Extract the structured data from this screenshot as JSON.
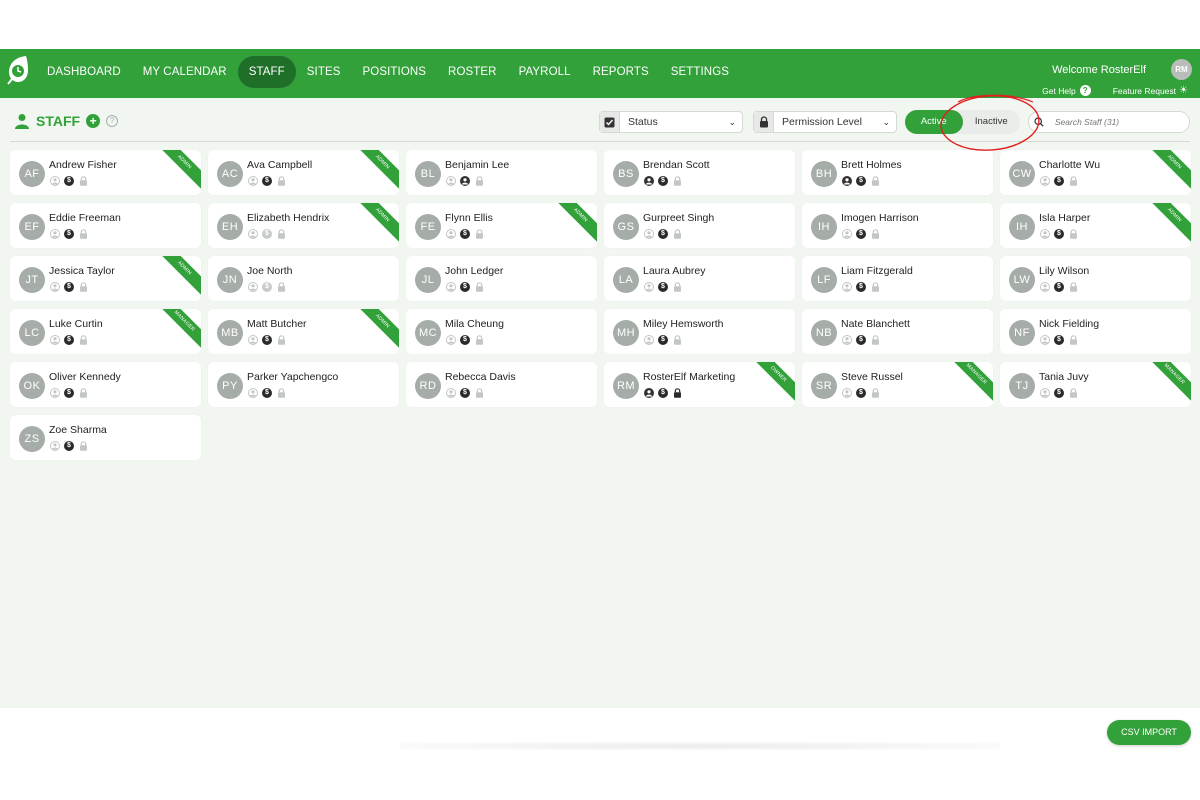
{
  "nav": {
    "items": [
      {
        "label": "DASHBOARD",
        "active": false
      },
      {
        "label": "MY CALENDAR",
        "active": false
      },
      {
        "label": "STAFF",
        "active": true
      },
      {
        "label": "SITES",
        "active": false
      },
      {
        "label": "POSITIONS",
        "active": false
      },
      {
        "label": "ROSTER",
        "active": false
      },
      {
        "label": "PAYROLL",
        "active": false
      },
      {
        "label": "REPORTS",
        "active": false
      },
      {
        "label": "SETTINGS",
        "active": false
      }
    ],
    "welcome": "Welcome RosterElf",
    "user_initials": "RM",
    "get_help": "Get Help",
    "feature_request": "Feature Request"
  },
  "page": {
    "title": "STAFF",
    "status_filter": "Status",
    "permission_filter": "Permission Level",
    "toggle_active": "Active",
    "toggle_inactive": "Inactive",
    "search_placeholder": "Search Staff (31)",
    "csv_import": "CSV IMPORT"
  },
  "colors": {
    "brand_green": "#33a13a",
    "active_nav": "#1f6f28",
    "annotation": "#e02020"
  },
  "staff": [
    {
      "initials": "AF",
      "name": "Andrew Fisher",
      "badge": "ADMIN",
      "icons": [
        "user-off",
        "dollar-on",
        "lock-off"
      ]
    },
    {
      "initials": "AC",
      "name": "Ava Campbell",
      "badge": "ADMIN",
      "icons": [
        "user-off",
        "dollar-on",
        "lock-off"
      ]
    },
    {
      "initials": "BL",
      "name": "Benjamin Lee",
      "badge": "",
      "icons": [
        "user-off",
        "user-on",
        "lock-off"
      ]
    },
    {
      "initials": "BS",
      "name": "Brendan Scott",
      "badge": "",
      "icons": [
        "user-on",
        "dollar-on",
        "lock-off"
      ]
    },
    {
      "initials": "BH",
      "name": "Brett Holmes",
      "badge": "",
      "icons": [
        "user-on",
        "dollar-on",
        "lock-off"
      ]
    },
    {
      "initials": "CW",
      "name": "Charlotte Wu",
      "badge": "ADMIN",
      "icons": [
        "user-off",
        "dollar-on",
        "lock-off"
      ]
    },
    {
      "initials": "EF",
      "name": "Eddie Freeman",
      "badge": "",
      "icons": [
        "user-off",
        "dollar-on",
        "lock-off"
      ]
    },
    {
      "initials": "EH",
      "name": "Elizabeth Hendrix",
      "badge": "ADMIN",
      "icons": [
        "user-off",
        "dollar-off",
        "lock-off"
      ]
    },
    {
      "initials": "FE",
      "name": "Flynn Ellis",
      "badge": "ADMIN",
      "icons": [
        "user-off",
        "dollar-on",
        "lock-off"
      ]
    },
    {
      "initials": "GS",
      "name": "Gurpreet Singh",
      "badge": "",
      "icons": [
        "user-off",
        "dollar-on",
        "lock-off"
      ]
    },
    {
      "initials": "IH",
      "name": "Imogen Harrison",
      "badge": "",
      "icons": [
        "user-off",
        "dollar-on",
        "lock-off"
      ]
    },
    {
      "initials": "IH",
      "name": "Isla Harper",
      "badge": "ADMIN",
      "icons": [
        "user-off",
        "dollar-on",
        "lock-off"
      ]
    },
    {
      "initials": "JT",
      "name": "Jessica Taylor",
      "badge": "ADMIN",
      "icons": [
        "user-off",
        "dollar-on",
        "lock-off"
      ]
    },
    {
      "initials": "JN",
      "name": "Joe North",
      "badge": "",
      "icons": [
        "user-off",
        "dollar-off",
        "lock-off"
      ]
    },
    {
      "initials": "JL",
      "name": "John Ledger",
      "badge": "",
      "icons": [
        "user-off",
        "dollar-on",
        "lock-off"
      ]
    },
    {
      "initials": "LA",
      "name": "Laura Aubrey",
      "badge": "",
      "icons": [
        "user-off",
        "dollar-on",
        "lock-off"
      ]
    },
    {
      "initials": "LF",
      "name": "Liam Fitzgerald",
      "badge": "",
      "icons": [
        "user-off",
        "dollar-on",
        "lock-off"
      ]
    },
    {
      "initials": "LW",
      "name": "Lily Wilson",
      "badge": "",
      "icons": [
        "user-off",
        "dollar-on",
        "lock-off"
      ]
    },
    {
      "initials": "LC",
      "name": "Luke Curtin",
      "badge": "MANAGER",
      "icons": [
        "user-off",
        "dollar-on",
        "lock-off"
      ]
    },
    {
      "initials": "MB",
      "name": "Matt Butcher",
      "badge": "ADMIN",
      "icons": [
        "user-off",
        "dollar-on",
        "lock-off"
      ]
    },
    {
      "initials": "MC",
      "name": "Mila Cheung",
      "badge": "",
      "icons": [
        "user-off",
        "dollar-on",
        "lock-off"
      ]
    },
    {
      "initials": "MH",
      "name": "Miley Hemsworth",
      "badge": "",
      "icons": [
        "user-off",
        "dollar-on",
        "lock-off"
      ]
    },
    {
      "initials": "NB",
      "name": "Nate Blanchett",
      "badge": "",
      "icons": [
        "user-off",
        "dollar-on",
        "lock-off"
      ]
    },
    {
      "initials": "NF",
      "name": "Nick Fielding",
      "badge": "",
      "icons": [
        "user-off",
        "dollar-on",
        "lock-off"
      ]
    },
    {
      "initials": "OK",
      "name": "Oliver Kennedy",
      "badge": "",
      "icons": [
        "user-off",
        "dollar-on",
        "lock-off"
      ]
    },
    {
      "initials": "PY",
      "name": "Parker Yapchengco",
      "badge": "",
      "icons": [
        "user-off",
        "dollar-on",
        "lock-off"
      ]
    },
    {
      "initials": "RD",
      "name": "Rebecca Davis",
      "badge": "",
      "icons": [
        "user-off",
        "dollar-on",
        "lock-off"
      ]
    },
    {
      "initials": "RM",
      "name": "RosterElf Marketing",
      "badge": "OWNER",
      "icons": [
        "user-on",
        "dollar-on",
        "lock-on"
      ]
    },
    {
      "initials": "SR",
      "name": "Steve Russel",
      "badge": "MANAGER",
      "icons": [
        "user-off",
        "dollar-on",
        "lock-off"
      ]
    },
    {
      "initials": "TJ",
      "name": "Tania Juvy",
      "badge": "MANAGER",
      "icons": [
        "user-off",
        "dollar-on",
        "lock-off"
      ]
    },
    {
      "initials": "ZS",
      "name": "Zoe Sharma",
      "badge": "",
      "icons": [
        "user-off",
        "dollar-on",
        "lock-off"
      ]
    }
  ]
}
